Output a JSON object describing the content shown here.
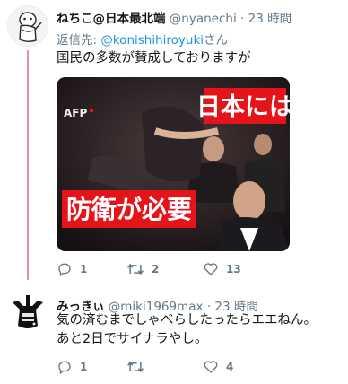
{
  "tweet1": {
    "name": "ねちこ@日本最北端",
    "handle": "@nyanechi",
    "dot": "·",
    "time": "23 時間",
    "reply_prefix": "返信先: ",
    "reply_mention": "@konishihiroyuki",
    "reply_suffix": "さん",
    "text": "国民の多数が賛成しております​が",
    "media": {
      "watermark": "AFP",
      "caption_top": "日本には",
      "caption_bottom": "防衛が必要"
    },
    "actions": {
      "reply_count": "1",
      "retweet_count": "2",
      "like_count": "13"
    }
  },
  "tweet2": {
    "name": "みっきぃ",
    "handle": "@miki1969max",
    "dot": "·",
    "time": "23 時間",
    "text_line1": "気の済むまでしゃべらしたったらエエねん。",
    "text_line2": "あと2日でサイナラやし。",
    "actions": {
      "reply_count": "1",
      "retweet_count": "",
      "like_count": "4"
    }
  },
  "colors": {
    "thread_line": "#e88ea7",
    "mention": "#1b95e0",
    "meta_gray": "#657786",
    "caption_red": "#e5141b"
  },
  "icons": [
    "reply-icon",
    "retweet-icon",
    "like-icon"
  ]
}
